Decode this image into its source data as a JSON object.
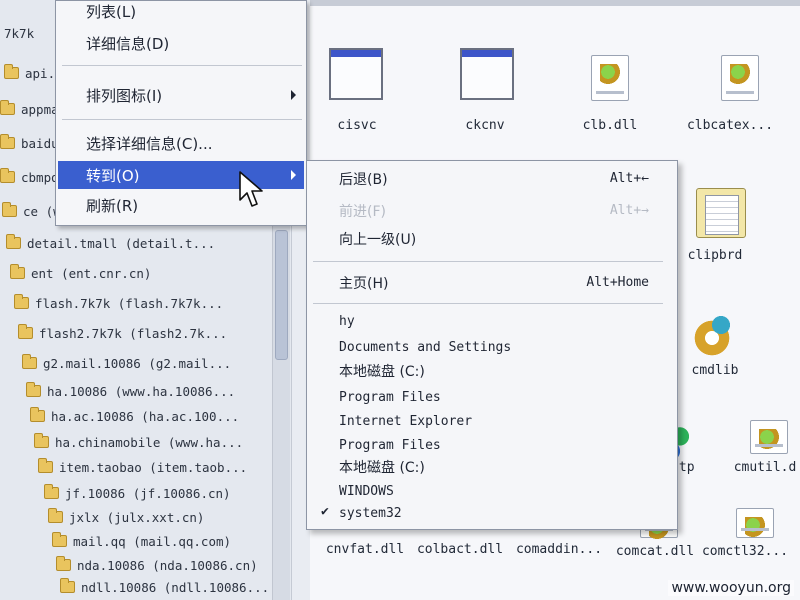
{
  "tree": {
    "items": [
      {
        "label": "7k7k"
      },
      {
        "label": "api.t"
      },
      {
        "label": "appmai"
      },
      {
        "label": "baidu"
      },
      {
        "label": "cbmpd"
      },
      {
        "label": "ce (ww"
      },
      {
        "label": "detail.tmall (detail.t..."
      },
      {
        "label": "ent (ent.cnr.cn)"
      },
      {
        "label": "flash.7k7k (flash.7k7k..."
      },
      {
        "label": "flash2.7k7k (flash2.7k..."
      },
      {
        "label": "g2.mail.10086 (g2.mail..."
      },
      {
        "label": "ha.10086 (www.ha.10086..."
      },
      {
        "label": "ha.ac.10086 (ha.ac.100..."
      },
      {
        "label": "ha.chinamobile (www.ha..."
      },
      {
        "label": "item.taobao (item.taob..."
      },
      {
        "label": "jf.10086 (jf.10086.cn)"
      },
      {
        "label": "jxlx (julx.xxt.cn)"
      },
      {
        "label": "mail.qq (mail.qq.com)"
      },
      {
        "label": "nda.10086 (nda.10086.cn)"
      },
      {
        "label": "ndll.10086 (ndll.10086..."
      }
    ]
  },
  "files": {
    "items": [
      {
        "label": "cisvc",
        "icon": "window-app-icon"
      },
      {
        "label": "ckcnv",
        "icon": "window-app-icon"
      },
      {
        "label": "clb.dll",
        "icon": "dll-icon"
      },
      {
        "label": "clbcatex...",
        "icon": "dll-icon"
      },
      {
        "label": "clipbrd",
        "icon": "clipboard-icon"
      },
      {
        "label": "cmdlib",
        "icon": "gear-icon"
      },
      {
        "label": "cmstp",
        "icon": "puzzle-icon"
      },
      {
        "label": "cmutil.d",
        "icon": "dll-icon"
      },
      {
        "label": "cnvfat.dll",
        "icon": "dll-icon"
      },
      {
        "label": "colbact.dll",
        "icon": "dll-icon"
      },
      {
        "label": "comaddin...",
        "icon": "dll-icon"
      },
      {
        "label": "comcat.dll",
        "icon": "dll-icon"
      },
      {
        "label": "comctl32...",
        "icon": "dll-icon"
      }
    ]
  },
  "menu": {
    "items": [
      {
        "label": "列表(L)"
      },
      {
        "label": "详细信息(D)"
      },
      {
        "label": "排列图标(I)"
      },
      {
        "label": "选择详细信息(C)..."
      },
      {
        "label": "转到(O)"
      },
      {
        "label": "刷新(R)"
      }
    ]
  },
  "submenu": {
    "back": {
      "label": "后退(B)",
      "shortcut": "Alt+←"
    },
    "forward": {
      "label": "前进(F)",
      "shortcut": "Alt+→"
    },
    "up": {
      "label": "向上一级(U)"
    },
    "home": {
      "label": "主页(H)",
      "shortcut": "Alt+Home"
    },
    "history": [
      {
        "label": "hy"
      },
      {
        "label": "Documents and Settings"
      },
      {
        "label": "本地磁盘 (C:)"
      },
      {
        "label": "Program Files"
      },
      {
        "label": "Internet Explorer"
      },
      {
        "label": "Program Files"
      },
      {
        "label": "本地磁盘 (C:)"
      },
      {
        "label": "WINDOWS"
      },
      {
        "label": "system32",
        "checked": true
      }
    ]
  },
  "watermark": "www.wooyun.org",
  "colors": {
    "menu_highlight": "#3a5fcf",
    "folder": "#e9c45e"
  }
}
